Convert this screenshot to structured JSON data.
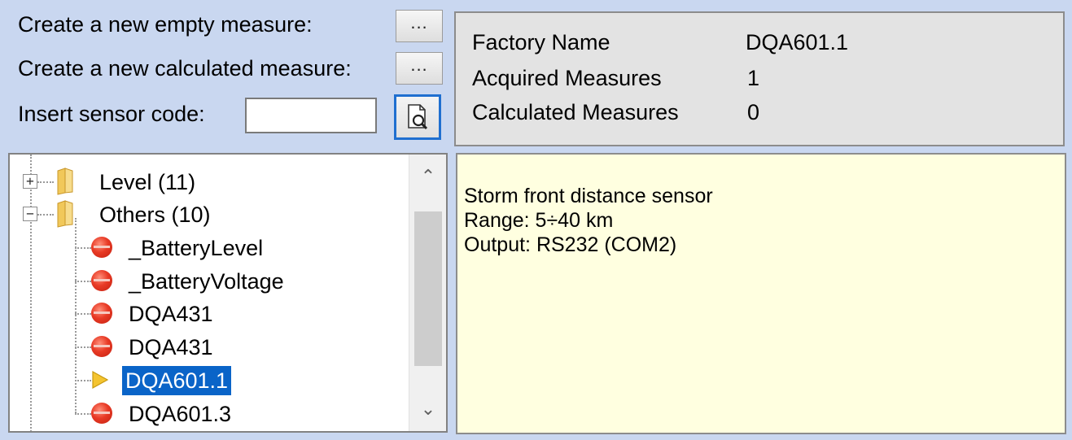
{
  "controls": {
    "empty_measure_label": "Create a new empty  measure:",
    "calculated_measure_label": "Create a new calculated  measure:",
    "sensor_code_label": "Insert sensor code:",
    "ellipsis_label": "...",
    "sensor_code_value": ""
  },
  "info": {
    "factory_name_label": "Factory Name",
    "factory_name_value": "DQA601.1",
    "acquired_label": "Acquired Measures",
    "acquired_value": "1",
    "calculated_label": "Calculated Measures",
    "calculated_value": "0"
  },
  "tree": {
    "groups": [
      {
        "label": "Level (11)",
        "expanded": false
      },
      {
        "label": "Others (10)",
        "expanded": true
      }
    ],
    "items": [
      {
        "label": "_BatteryLevel",
        "icon": "red-dot-icon"
      },
      {
        "label": "_BatteryVoltage",
        "icon": "red-dot-icon"
      },
      {
        "label": "DQA431",
        "icon": "red-dot-icon"
      },
      {
        "label": "DQA431",
        "icon": "red-dot-icon"
      },
      {
        "label": "DQA601.1",
        "icon": "yellow-arrow-icon",
        "selected": true
      },
      {
        "label": "DQA601.3",
        "icon": "red-dot-icon"
      }
    ]
  },
  "description": {
    "lines": [
      "Storm front distance sensor",
      "Range: 5÷40 km",
      "Output: RS232 (COM2)"
    ]
  },
  "colors": {
    "background": "#c9d7f0",
    "selection": "#0a64c8",
    "description_bg": "#ffffe0"
  }
}
